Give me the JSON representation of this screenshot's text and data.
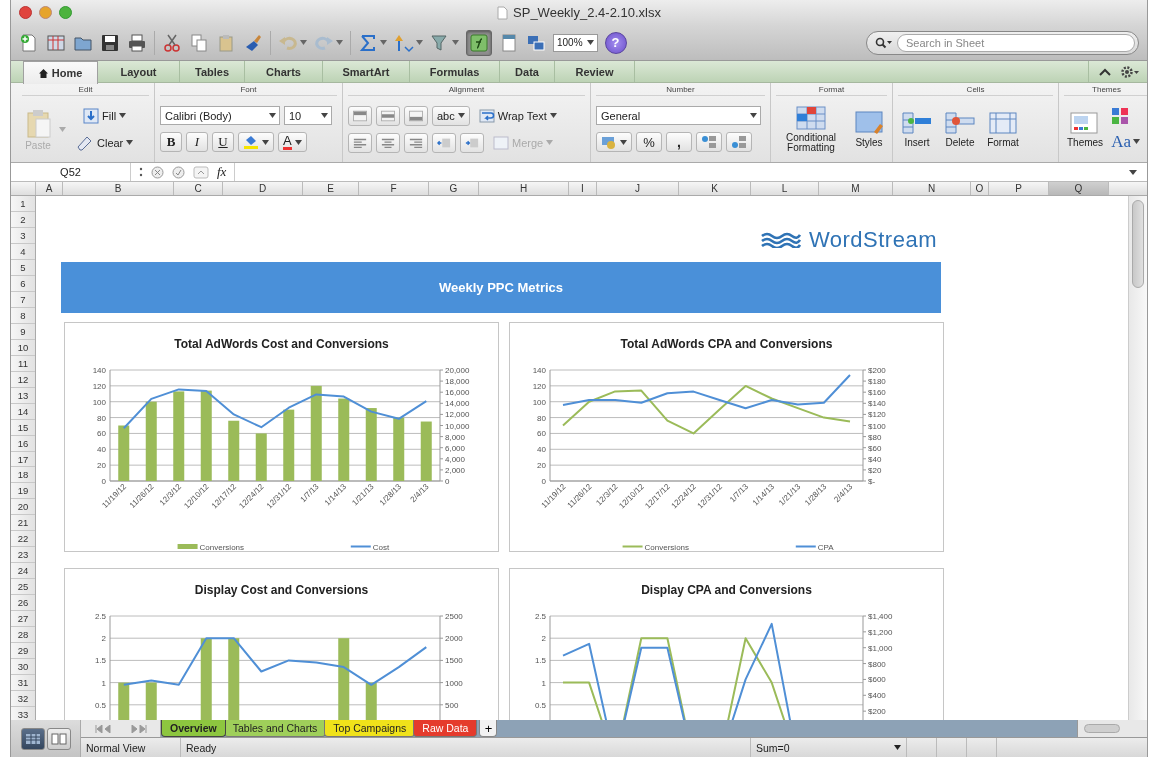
{
  "window": {
    "title": "SP_Weekly_2.4-2.10.xlsx"
  },
  "toolbar": {
    "formula_builder_on": true,
    "zoom": "100%",
    "help": "?",
    "search": {
      "placeholder": "Search in Sheet"
    }
  },
  "ribbon": {
    "tabs": [
      {
        "label": "Home",
        "selected": true
      },
      {
        "label": "Layout",
        "selected": false
      },
      {
        "label": "Tables",
        "selected": false
      },
      {
        "label": "Charts",
        "selected": false
      },
      {
        "label": "SmartArt",
        "selected": false
      },
      {
        "label": "Formulas",
        "selected": false
      },
      {
        "label": "Data",
        "selected": false
      },
      {
        "label": "Review",
        "selected": false
      }
    ],
    "groups": {
      "edit": {
        "title": "Edit",
        "paste": "Paste",
        "fill": "Fill",
        "clear": "Clear"
      },
      "font": {
        "title": "Font",
        "name": "Calibri (Body)",
        "size": "10",
        "bold": "B",
        "italic": "I",
        "underline": "U",
        "color_button": "A"
      },
      "alignment": {
        "title": "Alignment",
        "orientation": "abc",
        "wrap_text": "Wrap Text",
        "merge": {
          "label": "Merge",
          "disabled": true
        }
      },
      "number": {
        "title": "Number",
        "format": "General",
        "percent": "%",
        "comma": ","
      },
      "format": {
        "title": "Format",
        "conditional_formatting": "Conditional Formatting",
        "styles": "Styles"
      },
      "cells": {
        "title": "Cells",
        "insert": "Insert",
        "delete": "Delete",
        "format": "Format"
      },
      "themes": {
        "title": "Themes",
        "themes": "Themes",
        "fonts": "Aa"
      }
    }
  },
  "formula_bar": {
    "cell": "Q52",
    "fx": "fx"
  },
  "sheet": {
    "columns": [
      {
        "label": "A",
        "selected": false
      },
      {
        "label": "B",
        "selected": false
      },
      {
        "label": "C",
        "selected": false
      },
      {
        "label": "D",
        "selected": false
      },
      {
        "label": "E",
        "selected": false
      },
      {
        "label": "F",
        "selected": false
      },
      {
        "label": "G",
        "selected": false
      },
      {
        "label": "H",
        "selected": false
      },
      {
        "label": "I",
        "selected": false
      },
      {
        "label": "J",
        "selected": false
      },
      {
        "label": "K",
        "selected": false
      },
      {
        "label": "L",
        "selected": false
      },
      {
        "label": "M",
        "selected": false
      },
      {
        "label": "N",
        "selected": false
      },
      {
        "label": "O",
        "selected": false
      },
      {
        "label": "P",
        "selected": false
      },
      {
        "label": "Q",
        "selected": true
      }
    ],
    "rows": [
      "1",
      "2",
      "3",
      "4",
      "5",
      "6",
      "7",
      "8",
      "9",
      "10",
      "11",
      "12",
      "13",
      "14",
      "15",
      "16",
      "17",
      "18",
      "19",
      "20",
      "21",
      "22",
      "23",
      "24",
      "25",
      "26",
      "27",
      "28",
      "29",
      "30",
      "31",
      "32",
      "33"
    ],
    "logo": "WordStream",
    "banner": "Weekly PPC Metrics",
    "charts": [
      {
        "chart_data": {
          "type": "bar",
          "title": "Total AdWords Cost and Conversions",
          "grid": true,
          "legend": "bottom",
          "categories": [
            "11/19/12",
            "11/26/12",
            "12/3/12",
            "12/10/12",
            "12/17/12",
            "12/24/12",
            "12/31/12",
            "1/7/13",
            "1/14/13",
            "1/21/13",
            "1/28/13",
            "2/4/13"
          ],
          "ylim": [
            0,
            140
          ],
          "yticks": [
            0,
            20,
            40,
            60,
            80,
            100,
            120,
            140
          ],
          "y2lim": [
            0,
            20000
          ],
          "y2ticks": [
            {
              "value": 0,
              "label": "0"
            },
            {
              "value": 2000,
              "label": "2,000"
            },
            {
              "value": 4000,
              "label": "4,000"
            },
            {
              "value": 6000,
              "label": "6,000"
            },
            {
              "value": 8000,
              "label": "8,000"
            },
            {
              "value": 10000,
              "label": "10,000"
            },
            {
              "value": 12000,
              "label": "12,000"
            },
            {
              "value": 14000,
              "label": "14,000"
            },
            {
              "value": 16000,
              "label": "16,000"
            },
            {
              "value": 18000,
              "label": "18,000"
            },
            {
              "value": 20000,
              "label": "20,000"
            }
          ],
          "series": [
            {
              "name": "Conversions",
              "type": "bar",
              "color": "#9bbb59",
              "values": [
                70,
                100,
                113,
                114,
                76,
                60,
                90,
                120,
                104,
                92,
                80,
                75
              ]
            },
            {
              "name": "Cost",
              "type": "line",
              "axis": "y2",
              "color": "#4f8fd6",
              "values": [
                9500,
                14800,
                16500,
                16200,
                12000,
                9700,
                13200,
                15600,
                15200,
                12500,
                11200,
                14400
              ]
            }
          ]
        }
      },
      {
        "chart_data": {
          "type": "line",
          "title": "Total AdWords CPA and Conversions",
          "grid": true,
          "legend": "bottom",
          "categories": [
            "11/19/12",
            "11/26/12",
            "12/3/12",
            "12/10/12",
            "12/17/12",
            "12/24/12",
            "12/31/12",
            "1/7/13",
            "1/14/13",
            "1/21/13",
            "1/28/13",
            "2/4/13"
          ],
          "ylim": [
            0,
            140
          ],
          "yticks": [
            0,
            20,
            40,
            60,
            80,
            100,
            120,
            140
          ],
          "y2lim": [
            0,
            200
          ],
          "y2ticks": [
            {
              "value": 0,
              "label": "$-"
            },
            {
              "value": 20,
              "label": "$20"
            },
            {
              "value": 40,
              "label": "$40"
            },
            {
              "value": 60,
              "label": "$60"
            },
            {
              "value": 80,
              "label": "$80"
            },
            {
              "value": 100,
              "label": "$100"
            },
            {
              "value": 120,
              "label": "$120"
            },
            {
              "value": 140,
              "label": "$140"
            },
            {
              "value": 160,
              "label": "$160"
            },
            {
              "value": 180,
              "label": "$180"
            },
            {
              "value": 200,
              "label": "$200"
            }
          ],
          "series": [
            {
              "name": "Conversions",
              "type": "line",
              "color": "#9bbb59",
              "values": [
                70,
                100,
                113,
                114,
                76,
                60,
                90,
                120,
                104,
                92,
                80,
                75
              ]
            },
            {
              "name": "CPA",
              "type": "line",
              "axis": "y2",
              "color": "#4f8fd6",
              "values": [
                137,
                146,
                146,
                141,
                158,
                161,
                146,
                131,
                146,
                138,
                141,
                191
              ]
            }
          ]
        }
      },
      {
        "chart_data": {
          "type": "bar",
          "title": "Display Cost and Conversions",
          "grid": true,
          "ylim": [
            0,
            2.5
          ],
          "yticks": [
            0.5,
            1,
            1.5,
            2,
            2.5
          ],
          "y2lim": [
            0,
            2500
          ],
          "y2ticks": [
            500,
            1000,
            1500,
            2000,
            2500
          ],
          "series": [
            {
              "type": "bar",
              "color": "#9bbb59",
              "values": [
                1,
                1,
                0,
                2,
                2,
                0,
                0,
                0,
                2,
                1,
                0,
                0
              ]
            },
            {
              "type": "line",
              "axis": "y2",
              "color": "#4f8fd6",
              "values": [
                950,
                1050,
                950,
                2000,
                2000,
                1250,
                1500,
                1450,
                1350,
                950,
                1350,
                1800
              ]
            }
          ]
        }
      },
      {
        "chart_data": {
          "type": "line",
          "title": "Display CPA and Conversions",
          "grid": true,
          "ylim": [
            0,
            2.5
          ],
          "yticks": [
            0.5,
            1,
            1.5,
            2,
            2.5
          ],
          "y2lim": [
            0,
            1400
          ],
          "y2ticks": [
            {
              "value": 200,
              "label": "$200"
            },
            {
              "value": 400,
              "label": "$400"
            },
            {
              "value": 600,
              "label": "$600"
            },
            {
              "value": 800,
              "label": "$800"
            },
            {
              "value": 1000,
              "label": "$1,000"
            },
            {
              "value": 1200,
              "label": "$1,200"
            },
            {
              "value": 1400,
              "label": "$1,400"
            }
          ],
          "series": [
            {
              "type": "line",
              "color": "#9bbb59",
              "values": [
                1,
                1,
                null,
                2,
                2,
                null,
                null,
                2,
                1,
                null,
                null,
                null
              ]
            },
            {
              "type": "line",
              "axis": "y2",
              "color": "#4f8fd6",
              "values": [
                900,
                1050,
                null,
                1000,
                1000,
                null,
                null,
                600,
                1300,
                null,
                null,
                null
              ]
            }
          ]
        }
      }
    ]
  },
  "sheet_tabs": {
    "tabs": [
      {
        "label": "Overview",
        "color": "#8dc63f",
        "selected": true
      },
      {
        "label": "Tables and Charts",
        "color": "#9fcf5a",
        "selected": false
      },
      {
        "label": "Top Campaigns",
        "color": "#f0e21a",
        "selected": false
      },
      {
        "label": "Raw Data",
        "color": "#e53b2c",
        "selected": false
      }
    ],
    "add": "+"
  },
  "status_bar": {
    "view": "Normal View",
    "state": "Ready",
    "sum": "Sum=0"
  }
}
